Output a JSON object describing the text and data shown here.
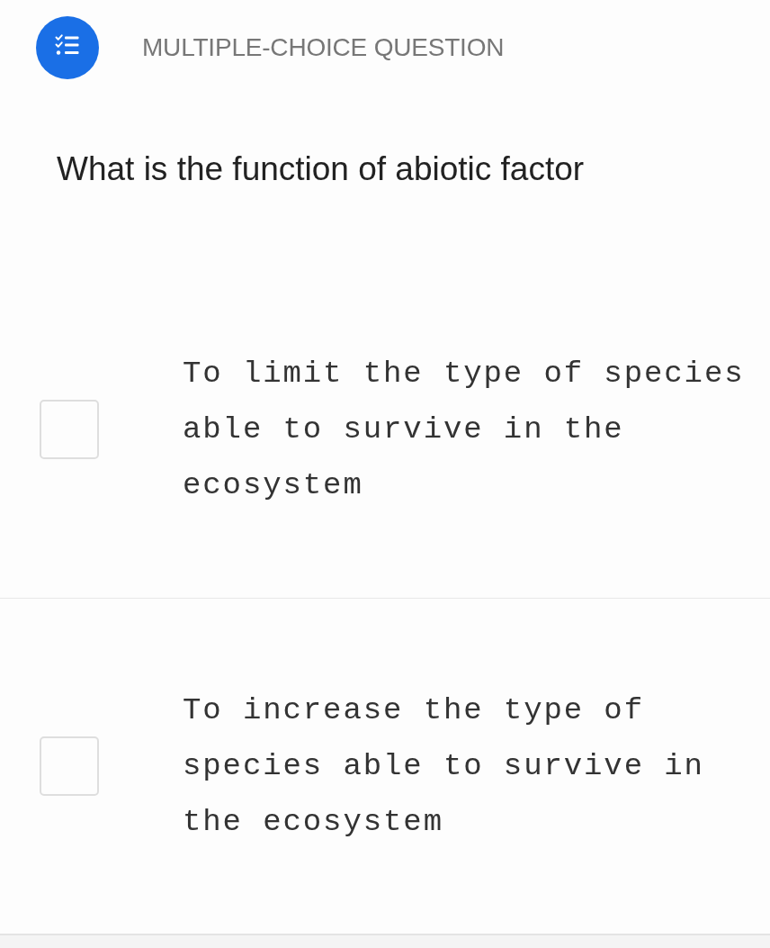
{
  "header": {
    "title": "MULTIPLE-CHOICE QUESTION"
  },
  "question": "What is the function of abiotic factor",
  "options": [
    {
      "text": "To limit the type of species able to survive in the ecosystem",
      "checked": false
    },
    {
      "text": "To increase the type of species able to survive in the ecosystem",
      "checked": false
    }
  ]
}
